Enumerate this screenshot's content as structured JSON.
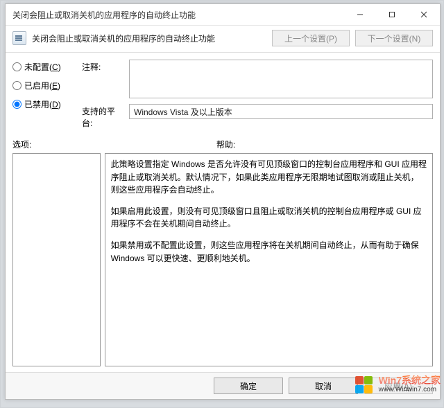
{
  "titlebar": {
    "title": "关闭会阻止或取消关机的应用程序的自动终止功能"
  },
  "header": {
    "title": "关闭会阻止或取消关机的应用程序的自动终止功能",
    "prev": "上一个设置(P)",
    "next": "下一个设置(N)"
  },
  "radios": {
    "not_configured": {
      "label": "未配置",
      "accel": "C"
    },
    "enabled": {
      "label": "已启用",
      "accel": "E"
    },
    "disabled": {
      "label": "已禁用",
      "accel": "D"
    },
    "selected": "disabled"
  },
  "fields": {
    "comment_label": "注释:",
    "comment_value": "",
    "platform_label": "支持的平台:",
    "platform_value": "Windows Vista 及以上版本"
  },
  "sections": {
    "options_label": "选项:",
    "help_label": "帮助:"
  },
  "help": {
    "p1": "此策略设置指定 Windows 是否允许没有可见顶级窗口的控制台应用程序和 GUI 应用程序阻止或取消关机。默认情况下，如果此类应用程序无限期地试图取消或阻止关机，则这些应用程序会自动终止。",
    "p2": "如果启用此设置，则没有可见顶级窗口且阻止或取消关机的控制台应用程序或 GUI 应用程序不会在关机期间自动终止。",
    "p3": "如果禁用或不配置此设置，则这些应用程序将在关机期间自动终止，从而有助于确保 Windows 可以更快速、更顺利地关机。"
  },
  "footer": {
    "ok": {
      "label": "确定"
    },
    "cancel": {
      "label": "取消"
    },
    "apply": {
      "label": "应用",
      "accel": "A"
    }
  },
  "watermark": {
    "cn": "Win7系统之家",
    "en": "www.Winwin7.com"
  }
}
